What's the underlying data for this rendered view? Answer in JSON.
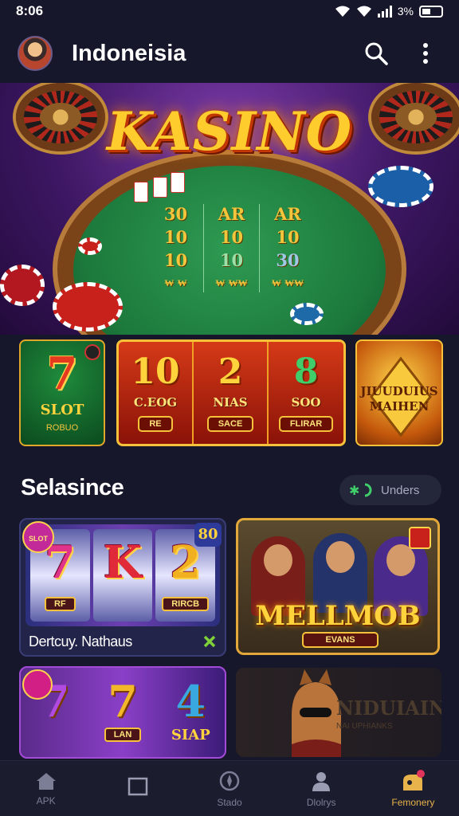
{
  "status_bar": {
    "time": "8:06",
    "battery_text": "3%"
  },
  "app_bar": {
    "title": "Indoneisia",
    "icons": [
      "avatar",
      "search-icon",
      "more-vert-icon"
    ]
  },
  "hero": {
    "title": "KASINO",
    "table_grid": [
      [
        "30",
        "AR",
        "AR"
      ],
      [
        "10",
        "10",
        "10"
      ],
      [
        "10",
        "10",
        "30"
      ]
    ],
    "table_chips": [
      "₩ ₩",
      "₩ ₩₩",
      "₩ ₩₩"
    ]
  },
  "promos": {
    "slot": {
      "symbol": "7",
      "title": "SLOT",
      "subtitle": "ROBUO"
    },
    "middle": [
      {
        "number": "10",
        "label": "C.EOG",
        "button": "RE"
      },
      {
        "number": "2",
        "label": "NIAS",
        "button": "SACE"
      },
      {
        "number": "8",
        "label": "SOO",
        "button": "FLIRAR"
      }
    ],
    "right": {
      "title": "JIUUDUIUS MAIHEN"
    }
  },
  "section": {
    "title": "Selasince",
    "pill_label": "Unders"
  },
  "games": {
    "reel_game": {
      "badge": "SLOT",
      "corner": "80",
      "symbols": [
        "7",
        "K",
        "2"
      ],
      "buttons": [
        "RF",
        "RIRCB"
      ],
      "caption": "Dertcuy. Nathaus"
    },
    "character_game": {
      "title": "MELLMOB",
      "button": "EVANS"
    },
    "slot_game_2": {
      "symbols": [
        "7",
        "7",
        "4"
      ],
      "labels": [
        "",
        "LAN",
        "SIAP"
      ]
    },
    "dark_game": {
      "title": "NIDUIAINS",
      "subtitle": "NAI UPHIANKS"
    }
  },
  "bottom_nav": [
    {
      "label": "APK",
      "icon": "home-icon"
    },
    {
      "label": "",
      "icon": "square-icon"
    },
    {
      "label": "Stado",
      "icon": "compass-icon"
    },
    {
      "label": "Dlolrys",
      "icon": "person-icon"
    },
    {
      "label": "Femonery",
      "icon": "rewards-icon",
      "active": true
    }
  ],
  "colors": {
    "background": "#16172a",
    "accent": "#e7b34a",
    "notification": "#e0345a"
  }
}
